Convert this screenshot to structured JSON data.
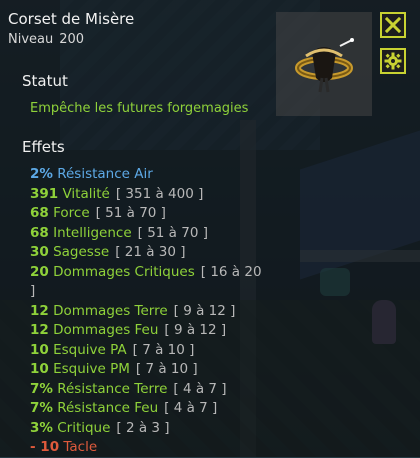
{
  "item": {
    "name": "Corset de Misère",
    "level_label": "Niveau",
    "level_value": "200"
  },
  "status": {
    "heading": "Statut",
    "text": "Empêche les futures forgemagies"
  },
  "effects_heading": "Effets",
  "effects": [
    {
      "value": "2%",
      "name": "Résistance Air",
      "range": "",
      "color": "blue"
    },
    {
      "value": "391",
      "name": "Vitalité",
      "range": "[ 351 à 400 ]",
      "color": "green"
    },
    {
      "value": "68",
      "name": "Force",
      "range": "[ 51 à 70 ]",
      "color": "green"
    },
    {
      "value": "68",
      "name": "Intelligence",
      "range": "[ 51 à 70 ]",
      "color": "green"
    },
    {
      "value": "30",
      "name": "Sagesse",
      "range": "[ 21 à 30 ]",
      "color": "green"
    },
    {
      "value": "20",
      "name": "Dommages Critiques",
      "range": "[ 16 à 20 ]",
      "color": "green"
    },
    {
      "value": "12",
      "name": "Dommages Terre",
      "range": "[ 9 à 12 ]",
      "color": "green"
    },
    {
      "value": "12",
      "name": "Dommages Feu",
      "range": "[ 9 à 12 ]",
      "color": "green"
    },
    {
      "value": "10",
      "name": "Esquive PA",
      "range": "[ 7 à 10 ]",
      "color": "green"
    },
    {
      "value": "10",
      "name": "Esquive PM",
      "range": "[ 7 à 10 ]",
      "color": "green"
    },
    {
      "value": "7%",
      "name": "Résistance Terre",
      "range": "[ 4 à 7 ]",
      "color": "green"
    },
    {
      "value": "7%",
      "name": "Résistance Feu",
      "range": "[ 4 à 7 ]",
      "color": "green"
    },
    {
      "value": "3%",
      "name": "Critique",
      "range": "[ 2 à 3 ]",
      "color": "green"
    },
    {
      "value": "- 10",
      "name": "Tacle",
      "range": "",
      "color": "red"
    }
  ],
  "icons": {
    "close": "close-icon",
    "settings": "gear-icon",
    "item": "corset-item-icon"
  },
  "colors": {
    "accent_button_border": "#c8d232",
    "bonus_green": "#8fd23a",
    "bonus_blue": "#5da9e6",
    "malus_red": "#e05a3c"
  }
}
